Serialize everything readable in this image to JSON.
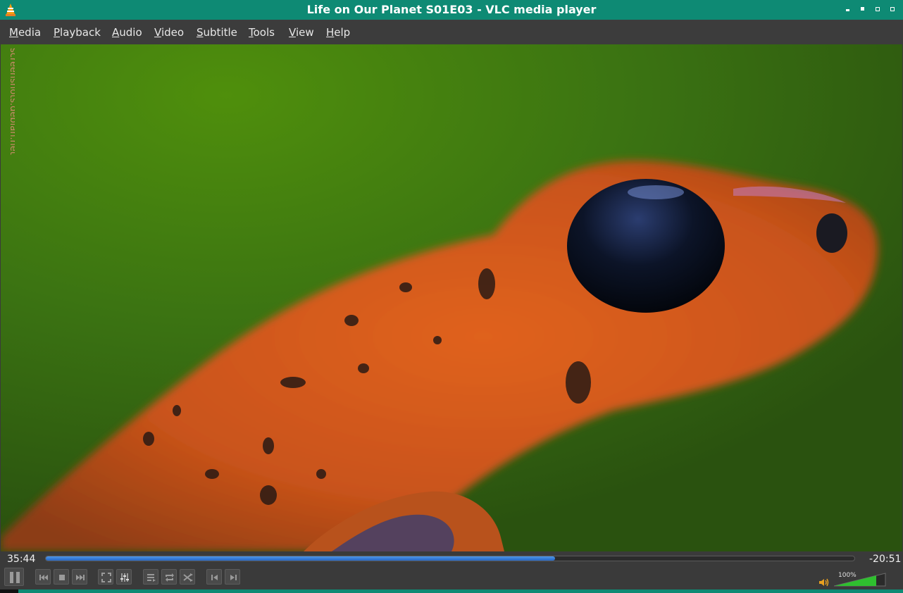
{
  "window": {
    "title": "Life on Our Planet S01E03 - VLC media player",
    "accent_color": "#0e8a74"
  },
  "menu": [
    {
      "label": "Media"
    },
    {
      "label": "Playback"
    },
    {
      "label": "Audio"
    },
    {
      "label": "Video"
    },
    {
      "label": "Subtitle"
    },
    {
      "label": "Tools"
    },
    {
      "label": "View"
    },
    {
      "label": "Help"
    }
  ],
  "video": {
    "watermark": "screenshots.debian.net"
  },
  "playback": {
    "elapsed": "35:44",
    "remaining": "-20:51",
    "progress_fraction": 0.63
  },
  "controls": {
    "buttons": [
      {
        "name": "pause-button",
        "icon": "pause-icon"
      },
      {
        "name": "previous-button",
        "icon": "skip-back-icon"
      },
      {
        "name": "stop-button",
        "icon": "stop-icon"
      },
      {
        "name": "next-button",
        "icon": "skip-forward-icon"
      },
      {
        "name": "fullscreen-button",
        "icon": "fullscreen-icon"
      },
      {
        "name": "extended-settings-button",
        "icon": "equalizer-icon"
      },
      {
        "name": "playlist-button",
        "icon": "playlist-icon"
      },
      {
        "name": "loop-button",
        "icon": "loop-icon"
      },
      {
        "name": "shuffle-button",
        "icon": "shuffle-icon"
      },
      {
        "name": "frame-back-button",
        "icon": "frame-back-icon"
      },
      {
        "name": "frame-forward-button",
        "icon": "frame-forward-icon"
      }
    ]
  },
  "volume": {
    "label": "100%",
    "level_fraction": 1.0,
    "color": "#2fbf2f"
  }
}
